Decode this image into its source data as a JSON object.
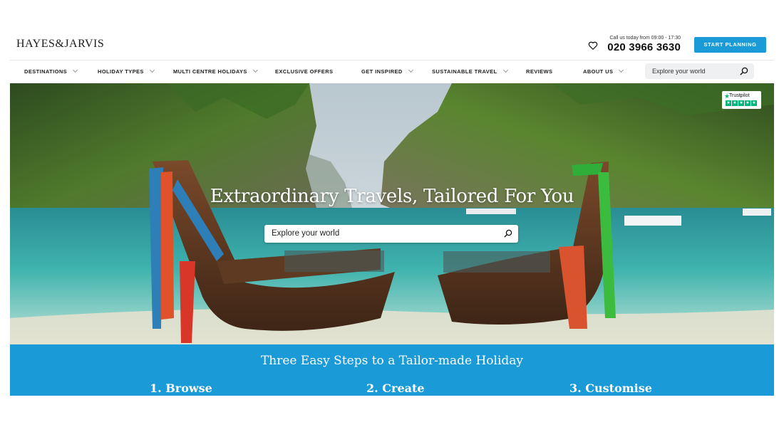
{
  "brand": {
    "logo_text": "HAYES&JARVIS"
  },
  "header": {
    "call_label": "Call us today from 09:00 - 17:30",
    "phone": "020 3966 3630",
    "cta_label": "START PLANNING",
    "favourites_icon": "heart-icon"
  },
  "nav": {
    "items": [
      {
        "label": "DESTINATIONS",
        "dropdown": true
      },
      {
        "label": "HOLIDAY TYPES",
        "dropdown": true
      },
      {
        "label": "MULTI CENTRE HOLIDAYS",
        "dropdown": true
      },
      {
        "label": "EXCLUSIVE OFFERS",
        "dropdown": false
      },
      {
        "label": "GET INSPIRED",
        "dropdown": true
      },
      {
        "label": "SUSTAINABLE TRAVEL",
        "dropdown": true
      },
      {
        "label": "REVIEWS",
        "dropdown": false
      },
      {
        "label": "ABOUT US",
        "dropdown": true
      }
    ],
    "search_placeholder": "Explore your world",
    "search_icon": "search-icon"
  },
  "hero": {
    "title": "Extraordinary Travels, Tailored For You",
    "search_placeholder": "Explore your world",
    "trustpilot_label": "Trustpilot",
    "trustpilot_stars": 5
  },
  "steps": {
    "title": "Three Easy Steps to a Tailor-made Holiday",
    "items": [
      "1. Browse",
      "2. Create",
      "3. Customise"
    ]
  },
  "colors": {
    "accent": "#1a9ad6",
    "trustpilot": "#00b67a"
  }
}
